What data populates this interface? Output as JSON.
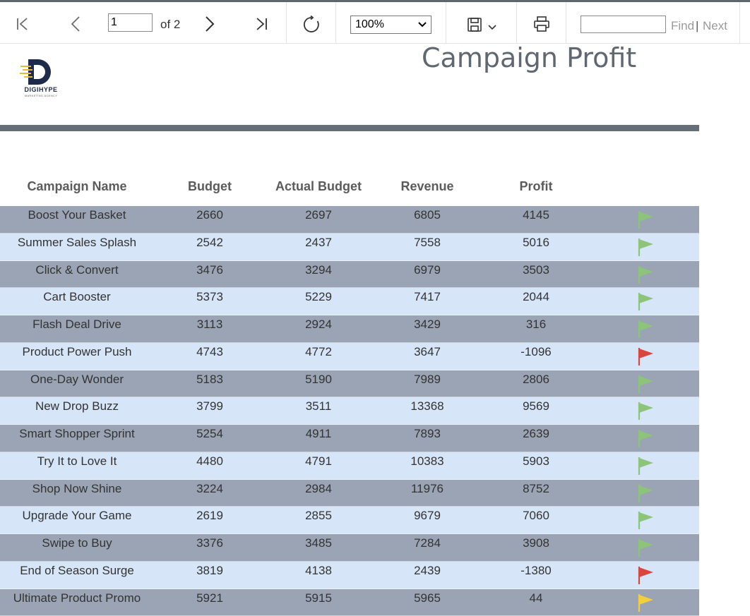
{
  "toolbar": {
    "current_page": "1",
    "of_pages": "of 2",
    "zoom": "100%",
    "find_placeholder": "",
    "find_label": "Find",
    "next_label": "Next",
    "pipe": "|"
  },
  "report": {
    "title": "Campaign Profit",
    "logo_text": "DIGIHYPE",
    "logo_subtext": "MARKETING AGENCY"
  },
  "table": {
    "headers": [
      "Campaign Name",
      "Budget",
      "Actual Budget",
      "Revenue",
      "Profit"
    ],
    "rows": [
      {
        "name": "Boost Your Basket",
        "budget": "2660",
        "actual": "2697",
        "revenue": "6805",
        "profit": "4145",
        "flag": "green"
      },
      {
        "name": "Summer Sales Splash",
        "budget": "2542",
        "actual": "2437",
        "revenue": "7558",
        "profit": "5016",
        "flag": "green"
      },
      {
        "name": "Click & Convert",
        "budget": "3476",
        "actual": "3294",
        "revenue": "6979",
        "profit": "3503",
        "flag": "green"
      },
      {
        "name": "Cart Booster",
        "budget": "5373",
        "actual": "5229",
        "revenue": "7417",
        "profit": "2044",
        "flag": "green"
      },
      {
        "name": "Flash Deal Drive",
        "budget": "3113",
        "actual": "2924",
        "revenue": "3429",
        "profit": "316",
        "flag": "green"
      },
      {
        "name": "Product Power Push",
        "budget": "4743",
        "actual": "4772",
        "revenue": "3647",
        "profit": "-1096",
        "flag": "red"
      },
      {
        "name": "One-Day Wonder",
        "budget": "5183",
        "actual": "5190",
        "revenue": "7989",
        "profit": "2806",
        "flag": "green"
      },
      {
        "name": "New Drop Buzz",
        "budget": "3799",
        "actual": "3511",
        "revenue": "13368",
        "profit": "9569",
        "flag": "green"
      },
      {
        "name": "Smart Shopper Sprint",
        "budget": "5254",
        "actual": "4911",
        "revenue": "7893",
        "profit": "2639",
        "flag": "green"
      },
      {
        "name": "Try It to Love It",
        "budget": "4480",
        "actual": "4791",
        "revenue": "10383",
        "profit": "5903",
        "flag": "green"
      },
      {
        "name": "Shop Now Shine",
        "budget": "3224",
        "actual": "2984",
        "revenue": "11976",
        "profit": "8752",
        "flag": "green"
      },
      {
        "name": "Upgrade Your Game",
        "budget": "2619",
        "actual": "2855",
        "revenue": "9679",
        "profit": "7060",
        "flag": "green"
      },
      {
        "name": "Swipe to Buy",
        "budget": "3376",
        "actual": "3485",
        "revenue": "7284",
        "profit": "3908",
        "flag": "green"
      },
      {
        "name": "End of Season Surge",
        "budget": "3819",
        "actual": "4138",
        "revenue": "2439",
        "profit": "-1380",
        "flag": "red"
      },
      {
        "name": "Ultimate Product Promo",
        "budget": "5921",
        "actual": "5915",
        "revenue": "5965",
        "profit": "44",
        "flag": "yellow"
      }
    ]
  },
  "colors": {
    "flag_green": "#8cc47a",
    "flag_red": "#d9463e",
    "flag_yellow": "#f2cf3c",
    "row_dark": "#9aa4b4",
    "row_light": "#d6e5f8",
    "title": "#5f6870",
    "logo_navy": "#1e2a4a",
    "logo_gold": "#e8b934"
  }
}
